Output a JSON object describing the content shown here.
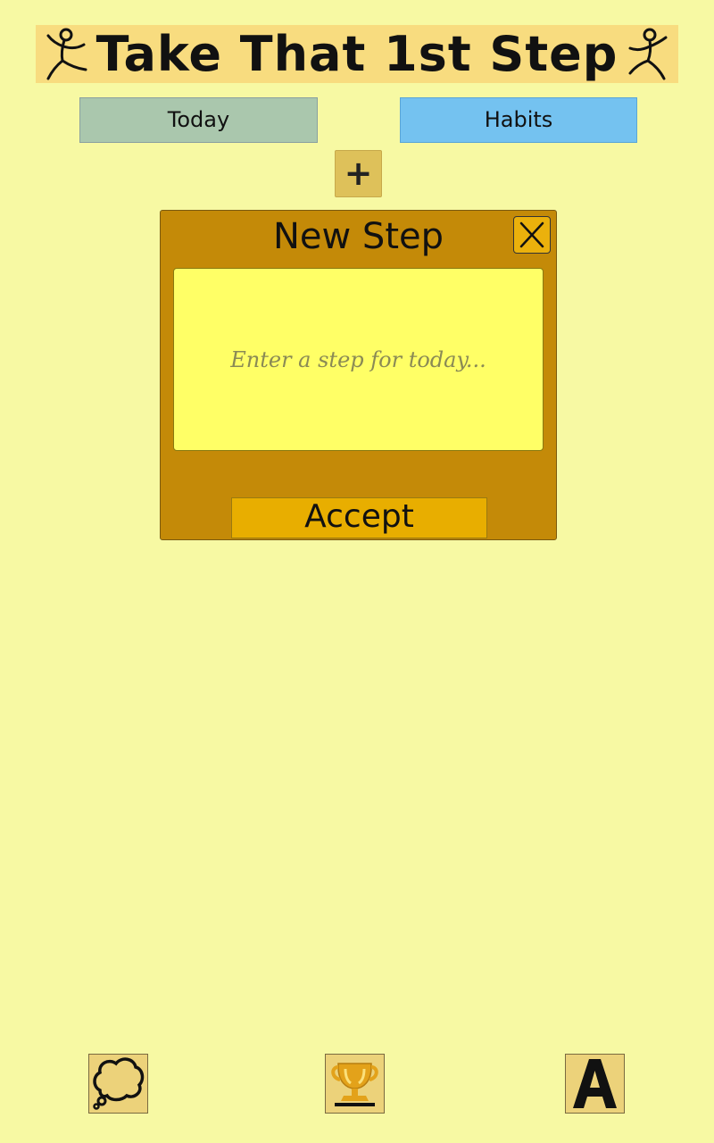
{
  "header": {
    "title": "Take That 1st Step",
    "left_icon": "stick-figure-icon",
    "right_icon": "stick-figure-icon"
  },
  "tabs": [
    {
      "label": "Today",
      "color": "#aac7ad"
    },
    {
      "label": "Habits",
      "color": "#74c2f0"
    }
  ],
  "add_button": {
    "label": "+"
  },
  "dialog": {
    "title": "New Step",
    "close_icon": "close-icon",
    "input_placeholder": "Enter a step for today...",
    "input_value": "",
    "accept_label": "Accept"
  },
  "bottom_bar": [
    {
      "icon": "thought-bubble-icon"
    },
    {
      "icon": "trophy-icon"
    },
    {
      "icon": "font-letter-a-icon"
    }
  ],
  "colors": {
    "background": "#f7f9a3",
    "header": "#f8dc7f",
    "dialog": "#c48a08",
    "input": "#ffff66",
    "accept": "#e8ae00"
  }
}
